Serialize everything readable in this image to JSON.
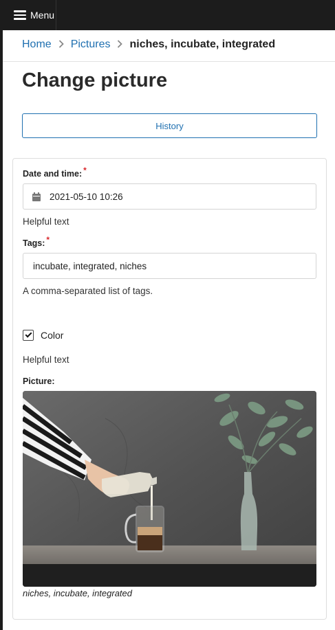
{
  "topbar": {
    "menu_label": "Menu"
  },
  "breadcrumb": {
    "home": "Home",
    "section": "Pictures",
    "current": "niches, incubate, integrated"
  },
  "page": {
    "title": "Change picture",
    "history_label": "History"
  },
  "form": {
    "datetime": {
      "label": "Date and time:",
      "required": "*",
      "value": "2021-05-10 10:26",
      "help": "Helpful text"
    },
    "tags": {
      "label": "Tags:",
      "required": "*",
      "value": "incubate, integrated, niches",
      "help": "A comma-separated list of tags."
    },
    "color": {
      "label": "Color",
      "checked": true,
      "help": "Helpful text"
    },
    "picture": {
      "label": "Picture:",
      "caption": "niches, incubate, integrated"
    }
  },
  "icons": {
    "menu": "hamburger-icon",
    "calendar": "calendar-icon",
    "breadcrumb_sep": "chevron-right-icon"
  }
}
